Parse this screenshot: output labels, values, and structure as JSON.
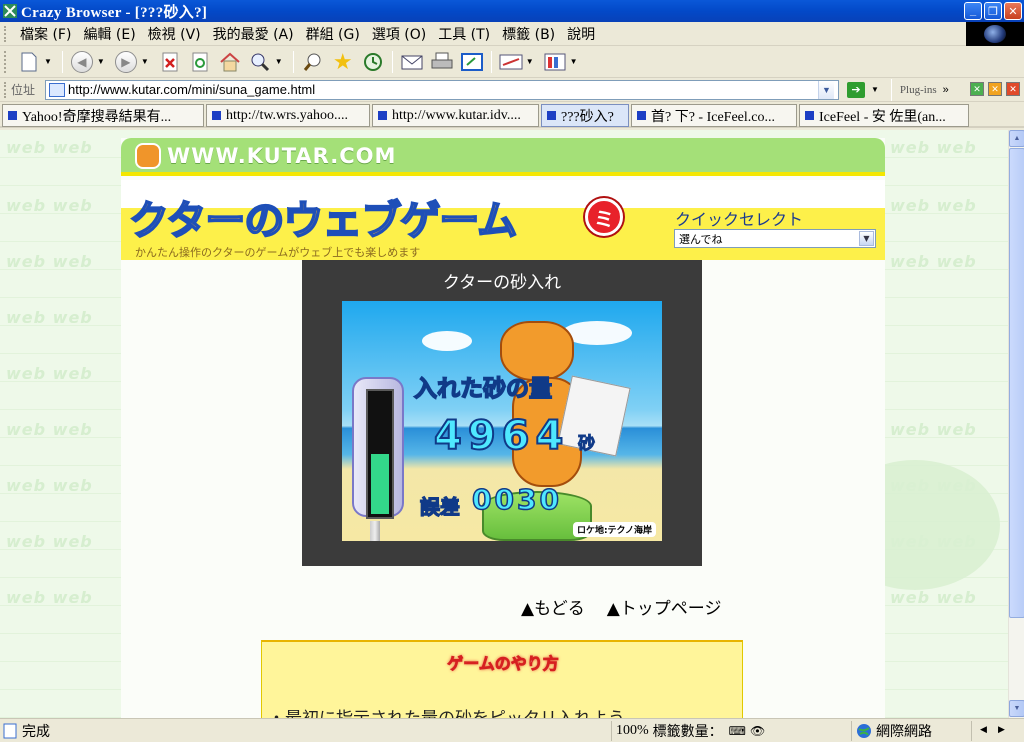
{
  "window": {
    "title": "Crazy Browser - [???砂入?]"
  },
  "menu": [
    "檔案 (F)",
    "編輯 (E)",
    "檢視 (V)",
    "我的最愛 (A)",
    "群組 (G)",
    "選項 (O)",
    "工具 (T)",
    "標籤 (B)",
    "說明"
  ],
  "address": {
    "label": "位址",
    "url": "http://www.kutar.com/mini/suna_game.html",
    "plugins": "Plug-ins"
  },
  "tabs": [
    {
      "label": "Yahoo!奇摩搜尋結果有..."
    },
    {
      "label": "http://tw.wrs.yahoo...."
    },
    {
      "label": "http://www.kutar.idv...."
    },
    {
      "label": "???砂入?",
      "active": true
    },
    {
      "label": "首? 下? - IceFeel.co..."
    },
    {
      "label": "IceFeel - 安 佐里(an..."
    }
  ],
  "page": {
    "site_name": "WWW.KUTAR.COM",
    "banner_title": "クターのウェブゲーム",
    "banner_badge": "ミ",
    "banner_subtitle": "かんたん操作のクターのゲームがウェブ上でも楽しめます",
    "quick_select_label": "クイックセレクト",
    "quick_select_value": "選んでね",
    "game_title": "クターの砂入れ",
    "game": {
      "amount_label": "入れた砂の量",
      "amount_value": "4964",
      "amount_unit": "砂",
      "error_label": "誤差",
      "error_value": "0030",
      "location": "ロケ地:テクノ海岸",
      "gauge_level": 0.5
    },
    "nav": {
      "back": "▲もどる",
      "top": "▲トップページ"
    },
    "howto_title": "ゲームのやり方",
    "howto_text": "・最初に指示された量の砂をピッタリ入れよう"
  },
  "status": {
    "text": "完成",
    "zoom": "100%",
    "tab_count_label": "標籤數量：",
    "zone": "網際網路"
  }
}
